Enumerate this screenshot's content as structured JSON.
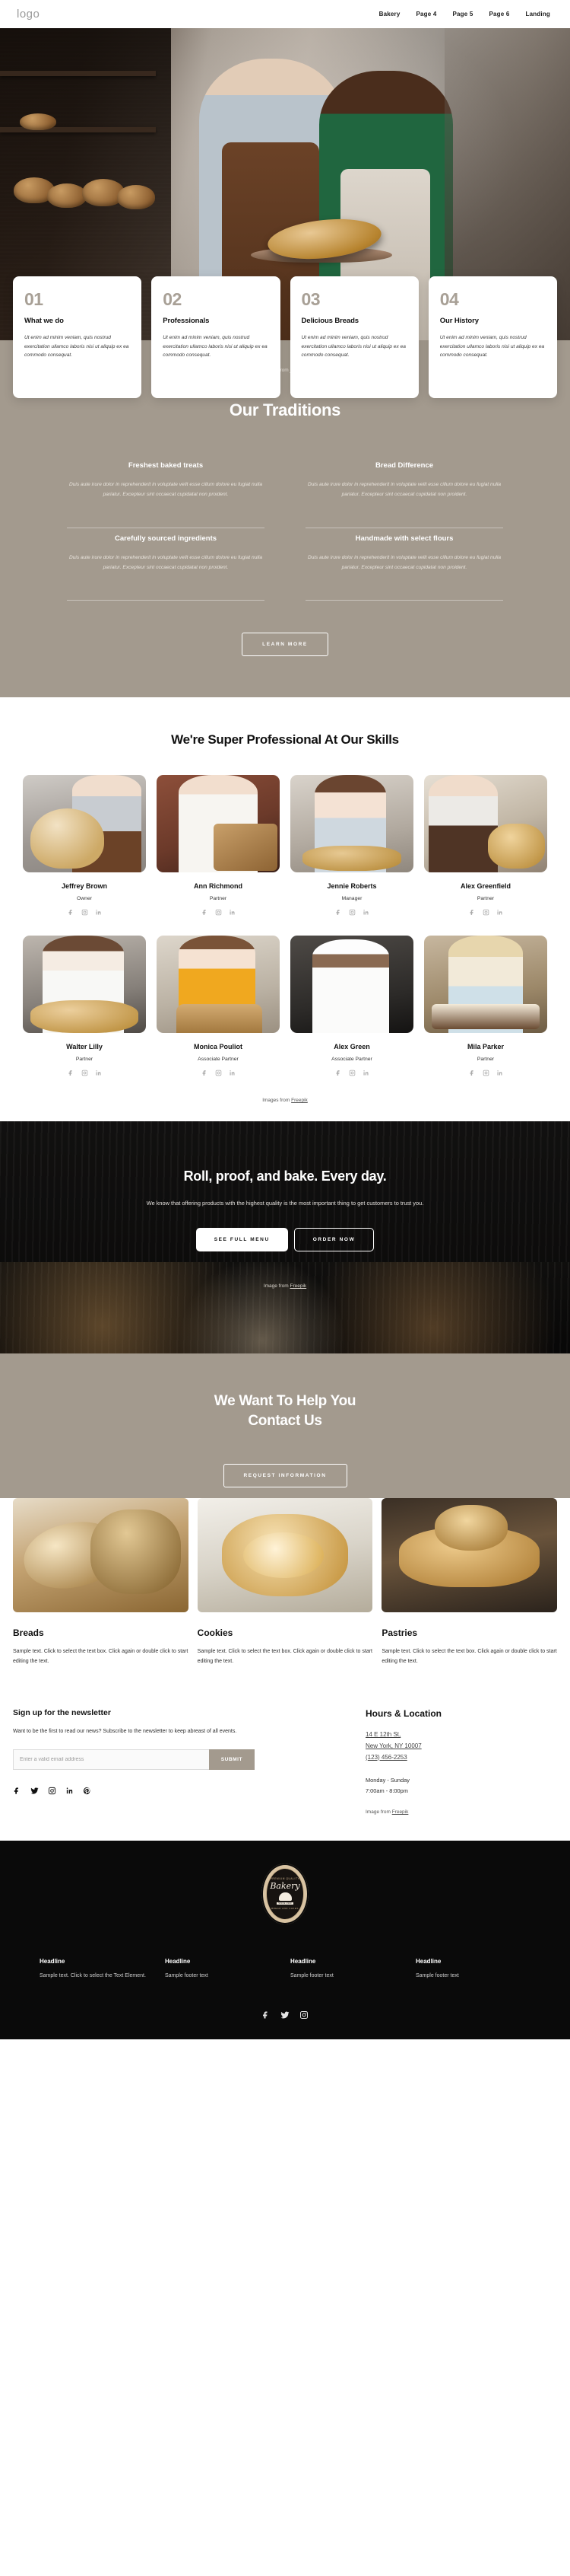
{
  "header": {
    "logo": "logo",
    "nav": [
      "Bakery",
      "Page 4",
      "Page 5",
      "Page 6",
      "Landing"
    ]
  },
  "hero": {
    "credit_prefix": "Image from ",
    "credit_link": "Freepik"
  },
  "feature_cards": [
    {
      "num": "01",
      "title": "What we do",
      "text": "Ut enim ad minim veniam, quis nostrud exercitation ullamco laboris nisi ut aliquip ex ea commodo consequat."
    },
    {
      "num": "02",
      "title": "Professionals",
      "text": "Ut enim ad minim veniam, quis nostrud exercitation ullamco laboris nisi ut aliquip ex ea commodo consequat."
    },
    {
      "num": "03",
      "title": "Delicious Breads",
      "text": "Ut enim ad minim veniam, quis nostrud exercitation ullamco laboris nisi ut aliquip ex ea commodo consequat."
    },
    {
      "num": "04",
      "title": "Our History",
      "text": "Ut enim ad minim veniam, quis nostrud exercitation ullamco laboris nisi ut aliquip ex ea commodo consequat."
    }
  ],
  "traditions": {
    "heading": "Our Traditions",
    "items": [
      {
        "title": "Freshest baked treats",
        "text": "Duis aute irure dolor in reprehenderit in voluptate velit esse cillum dolore eu fugiat nulla pariatur. Excepteur sint occaecat cupidatat non proident."
      },
      {
        "title": "Bread Difference",
        "text": "Duis aute irure dolor in reprehenderit in voluptate velit esse cillum dolore eu fugiat nulla pariatur. Excepteur sint occaecat cupidatat non proident."
      },
      {
        "title": "Carefully sourced ingredients",
        "text": "Duis aute irure dolor in reprehenderit in voluptate velit esse cillum dolore eu fugiat nulla pariatur. Excepteur sint occaecat cupidatat non proident."
      },
      {
        "title": "Handmade with select flours",
        "text": "Duis aute irure dolor in reprehenderit in voluptate velit esse cillum dolore eu fugiat nulla pariatur. Excepteur sint occaecat cupidatat non proident."
      }
    ],
    "button": "LEARN MORE"
  },
  "team": {
    "heading": "We're Super Professional At Our Skills",
    "members": [
      {
        "name": "Jeffrey Brown",
        "role": "Owner"
      },
      {
        "name": "Ann Richmond",
        "role": "Partner"
      },
      {
        "name": "Jennie Roberts",
        "role": "Manager"
      },
      {
        "name": "Alex Greenfield",
        "role": "Partner"
      },
      {
        "name": "Walter Lilly",
        "role": "Partner"
      },
      {
        "name": "Monica Pouliot",
        "role": "Associate Partner"
      },
      {
        "name": "Alex Green",
        "role": "Associate Partner"
      },
      {
        "name": "Mila Parker",
        "role": "Partner"
      }
    ],
    "credit_prefix": "Images from ",
    "credit_link": "Freepik"
  },
  "dark_cta": {
    "heading": "Roll, proof, and bake. Every day.",
    "paragraph": "We know that offering products with the highest quality is the most important thing to get customers to trust you.",
    "primary_button": "SEE FULL MENU",
    "secondary_button": "ORDER NOW",
    "credit_prefix": "Image from ",
    "credit_link": "Freepik"
  },
  "contact_band": {
    "heading_line1": "We Want To Help You",
    "heading_line2": "Contact Us",
    "button": "REQUEST INFORMATION"
  },
  "products": [
    {
      "title": "Breads",
      "text": "Sample text. Click to select the text box. Click again or double click to start editing the text."
    },
    {
      "title": "Cookies",
      "text": "Sample text. Click to select the text box. Click again or double click to start editing the text."
    },
    {
      "title": "Pastries",
      "text": "Sample text. Click to select the text box. Click again or double click to start editing the text."
    }
  ],
  "newsletter": {
    "title": "Sign up for the newsletter",
    "subtitle": "Want to be the first to read our news? Subscribe to the newsletter to keep abreast of all events.",
    "input_placeholder": "Enter a valid email address",
    "input_value": "",
    "submit_label": "SUBMIT"
  },
  "hours": {
    "title": "Hours & Location",
    "address_line1": "14 E 12th St,",
    "address_line2": "New York, NY 10007",
    "phone": "(123) 456-2253",
    "days": "Monday - Sunday",
    "time": "7:00am - 8:00pm",
    "credit_prefix": "Image from ",
    "credit_link": "Freepik"
  },
  "footer": {
    "badge": {
      "top_text": "PREMIUM QUALITY",
      "name": "Bakery",
      "since": "SINCE 1990",
      "bottom_text": "BREAD AND CAKES"
    },
    "columns": [
      {
        "head": "Headline",
        "text": "Sample text. Click to select the Text Element."
      },
      {
        "head": "Headline",
        "text": "Sample footer text"
      },
      {
        "head": "Headline",
        "text": "Sample footer text"
      },
      {
        "head": "Headline",
        "text": "Sample footer text"
      }
    ]
  },
  "icons": {
    "facebook": "facebook-icon",
    "twitter": "twitter-icon",
    "instagram": "instagram-icon",
    "linkedin": "linkedin-icon",
    "pinterest": "pinterest-icon"
  },
  "colors": {
    "accent_taupe": "#a39a8e",
    "dark": "#0a0a0a",
    "card_number": "#a8a096"
  }
}
